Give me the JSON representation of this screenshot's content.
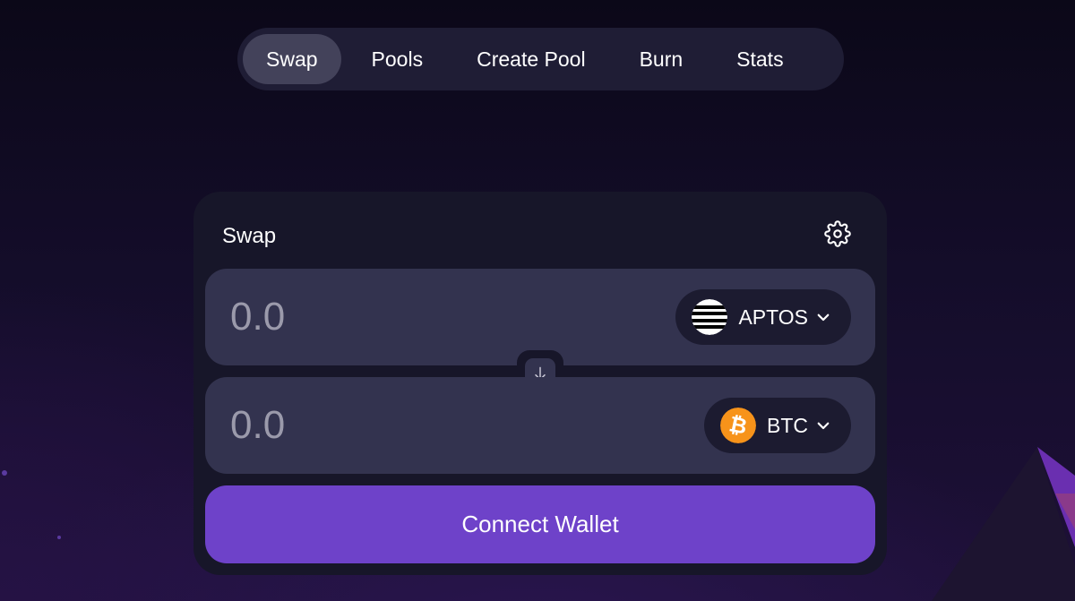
{
  "nav": {
    "tabs": [
      {
        "label": "Swap",
        "active": true
      },
      {
        "label": "Pools",
        "active": false
      },
      {
        "label": "Create Pool",
        "active": false
      },
      {
        "label": "Burn",
        "active": false
      },
      {
        "label": "Stats",
        "active": false
      }
    ]
  },
  "swap": {
    "title": "Swap",
    "settings_icon": "gear-icon",
    "from": {
      "placeholder": "0.0",
      "token": "APTOS",
      "token_icon": "aptos-logo-icon"
    },
    "to": {
      "placeholder": "0.0",
      "token": "BTC",
      "token_icon": "bitcoin-logo-icon"
    },
    "switch_icon": "arrow-down-icon",
    "connect_label": "Connect Wallet"
  },
  "colors": {
    "accent": "#6e42c9",
    "card": "#171629",
    "field": "#33334f",
    "bitcoin": "#f7931a"
  }
}
